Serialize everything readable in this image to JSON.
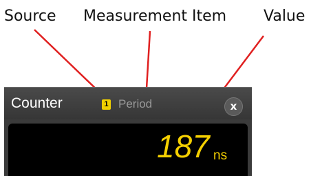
{
  "callouts": {
    "source": "Source",
    "measurement_item": "Measurement Item",
    "value": "Value"
  },
  "counter_widget": {
    "title": "Counter",
    "source_badge": "1",
    "measurement_item": "Period",
    "close_label": "x",
    "reading_value": "187",
    "reading_unit": "ns"
  },
  "colors": {
    "arrow": "#e02020",
    "source_badge": "#f0d000",
    "reading": "#f5d000",
    "panel": "#3b3b3b",
    "display": "#000000"
  },
  "icons": {
    "close": "close-icon",
    "arrow": "arrow-icon"
  }
}
